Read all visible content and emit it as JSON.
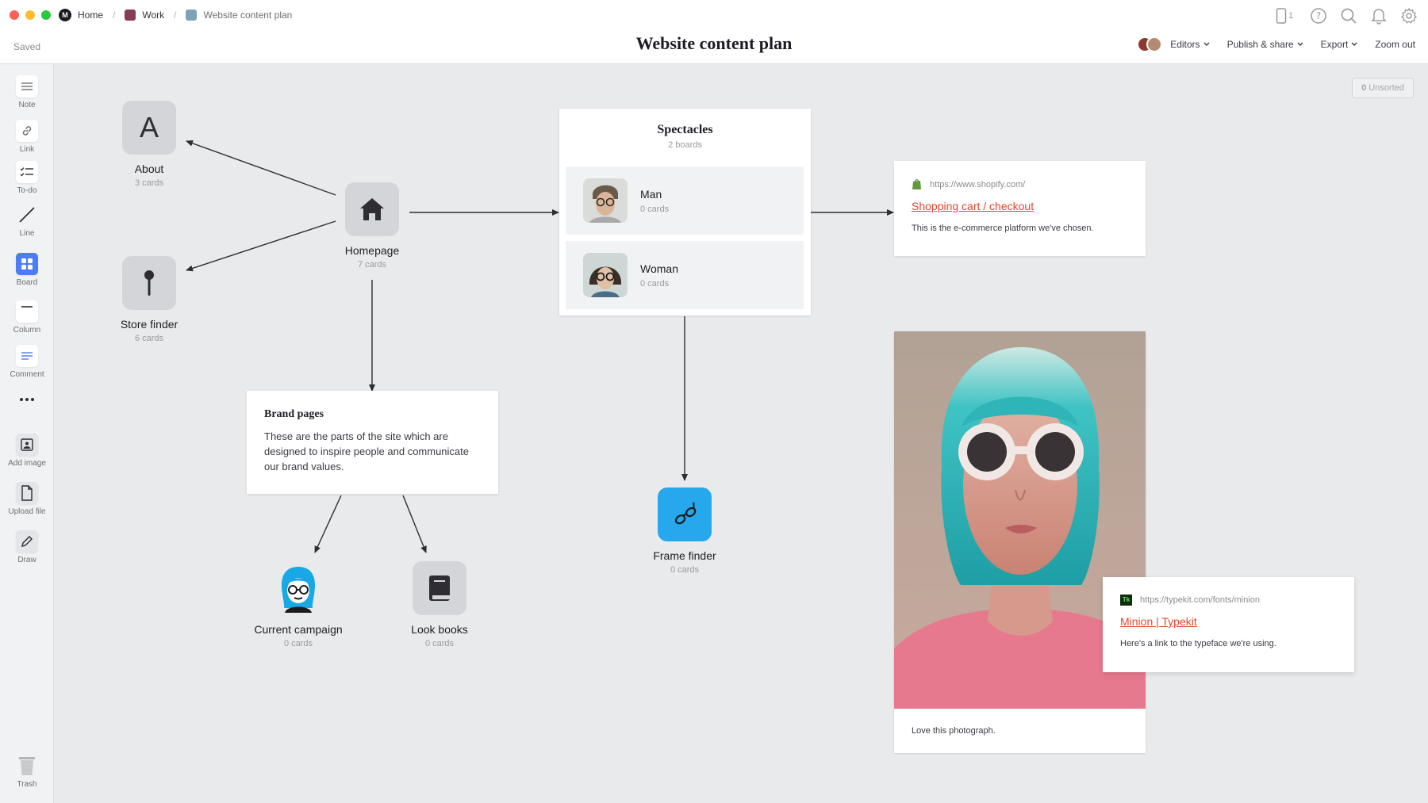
{
  "breadcrumbs": {
    "home": "Home",
    "work": "Work",
    "current": "Website content plan"
  },
  "header": {
    "saved": "Saved",
    "title": "Website content plan",
    "device_count": "1",
    "editors": "Editors",
    "publish": "Publish & share",
    "export": "Export",
    "zoom": "Zoom out"
  },
  "sidebar": {
    "note": "Note",
    "link": "Link",
    "todo": "To-do",
    "line": "Line",
    "board": "Board",
    "column": "Column",
    "comment": "Comment",
    "add_image": "Add image",
    "upload_file": "Upload file",
    "draw": "Draw",
    "trash": "Trash"
  },
  "canvas": {
    "unsorted_count": "0",
    "unsorted_label": "Unsorted",
    "about": {
      "letter": "A",
      "title": "About",
      "sub": "3 cards"
    },
    "store_finder": {
      "title": "Store finder",
      "sub": "6 cards"
    },
    "homepage": {
      "title": "Homepage",
      "sub": "7 cards"
    },
    "brand_pages": {
      "title": "Brand pages",
      "body": "These are the parts of the site which are designed to inspire people and communicate our brand values."
    },
    "current_campaign": {
      "title": "Current campaign",
      "sub": "0 cards"
    },
    "look_books": {
      "title": "Look books",
      "sub": "0 cards"
    },
    "spectacles": {
      "title": "Spectacles",
      "sub": "2 boards",
      "boards": [
        {
          "name": "Man",
          "count": "0 cards"
        },
        {
          "name": "Woman",
          "count": "0 cards"
        }
      ]
    },
    "frame_finder": {
      "title": "Frame finder",
      "sub": "0 cards"
    },
    "shopify_link": {
      "url": "https://www.shopify.com/",
      "title": "Shopping cart / checkout",
      "desc": "This is the e-commerce platform we've chosen."
    },
    "photo": {
      "caption": "Love this photograph."
    },
    "typekit_link": {
      "url": "https://typekit.com/fonts/minion",
      "title": "Minion | Typekit",
      "desc": "Here's a link to the typeface we're using."
    }
  },
  "colors": {
    "accent": "#4c7df4",
    "link": "#e8452f",
    "work_square": "#8a3b55",
    "page_square": "#7ea3b8"
  }
}
